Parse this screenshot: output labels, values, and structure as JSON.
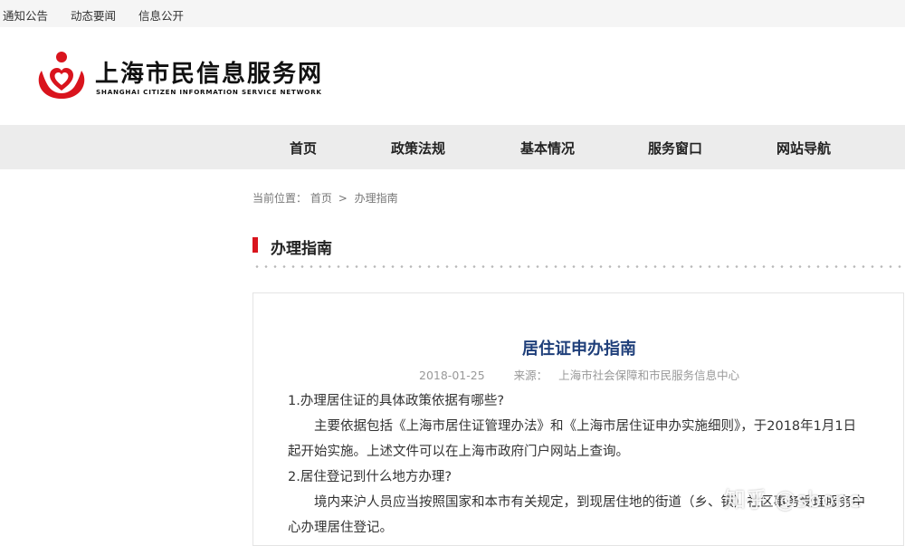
{
  "topbar": {
    "links": [
      "通知公告",
      "动态要闻",
      "信息公开"
    ]
  },
  "logo": {
    "name_cn": "上海市民信息服务网",
    "name_en": "SHANGHAI CITIZEN INFORMATION SERVICE NETWORK",
    "brand_color": "#d9141d"
  },
  "nav": {
    "items": [
      "首页",
      "政策法规",
      "基本情况",
      "服务窗口",
      "网站导航"
    ]
  },
  "breadcrumb": {
    "prefix": "当前位置：",
    "home": "首页",
    "separator": ">",
    "current": "办理指南"
  },
  "section": {
    "title": "办理指南",
    "accent": "#d9141d"
  },
  "article": {
    "title": "居住证申办指南",
    "date": "2018-01-25",
    "source_label": "来源：",
    "source": "上海市社会保障和市民服务信息中心",
    "paragraphs": [
      "1.办理居住证的具体政策依据有哪些?",
      "主要依据包括《上海市居住证管理办法》和《上海市居住证申办实施细则》，于2018年1月1日起开始实施。上述文件可以在上海市政府门户网站上查询。",
      "2.居住登记到什么地方办理?",
      "境内来沪人员应当按照国家和本市有关规定，到现居住地的街道（乡、镇）社区事务受理服务中心办理居住登记。"
    ]
  },
  "watermark": "知乎 @sbone"
}
